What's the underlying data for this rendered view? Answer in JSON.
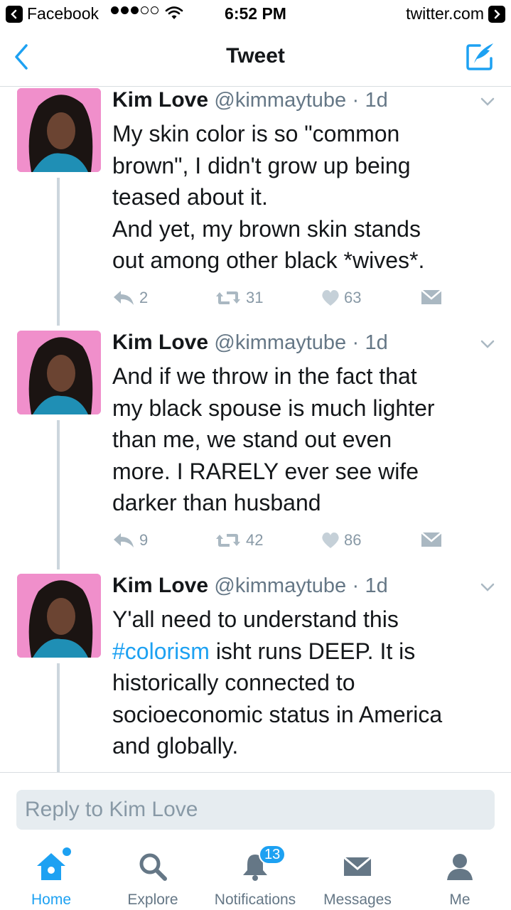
{
  "status_bar": {
    "back_app": "Facebook",
    "time": "6:52 PM",
    "forward_app": "twitter.com",
    "signal_filled": 3,
    "signal_total": 5
  },
  "nav": {
    "title": "Tweet"
  },
  "tweets": [
    {
      "name": "Kim Love",
      "handle": "@kimmaytube",
      "separator": "·",
      "time": "1d",
      "lines": [
        "My skin color is so \"common",
        "brown\", I didn't grow up being",
        "teased about it.",
        "And yet, my brown skin stands",
        "out among other black *wives*."
      ],
      "replies": "2",
      "retweets": "31",
      "likes": "63"
    },
    {
      "name": "Kim Love",
      "handle": "@kimmaytube",
      "separator": "·",
      "time": "1d",
      "lines": [
        "And if we throw in the fact that",
        "my black spouse is much lighter",
        "than me, we stand out even",
        "more. I RARELY ever see wife",
        "darker than husband"
      ],
      "replies": "9",
      "retweets": "42",
      "likes": "86"
    },
    {
      "name": "Kim Love",
      "handle": "@kimmaytube",
      "separator": "·",
      "time": "1d",
      "line1": "Y'all need to understand this",
      "hashtag": "#colorism",
      "line2_rest": " isht runs DEEP. It is",
      "line3": "historically connected to",
      "line4": "socioeconomic status in America",
      "line5": "and globally."
    }
  ],
  "reply": {
    "placeholder": "Reply to Kim Love"
  },
  "tabs": [
    {
      "label": "Home",
      "icon": "home-icon",
      "active": true
    },
    {
      "label": "Explore",
      "icon": "search-icon"
    },
    {
      "label": "Notifications",
      "icon": "bell-icon",
      "badge": "13"
    },
    {
      "label": "Messages",
      "icon": "envelope-icon"
    },
    {
      "label": "Me",
      "icon": "person-icon"
    }
  ],
  "colors": {
    "accent": "#1da1f2",
    "text": "#14171a",
    "secondary": "#657786",
    "icon_gray": "#8899a6"
  }
}
